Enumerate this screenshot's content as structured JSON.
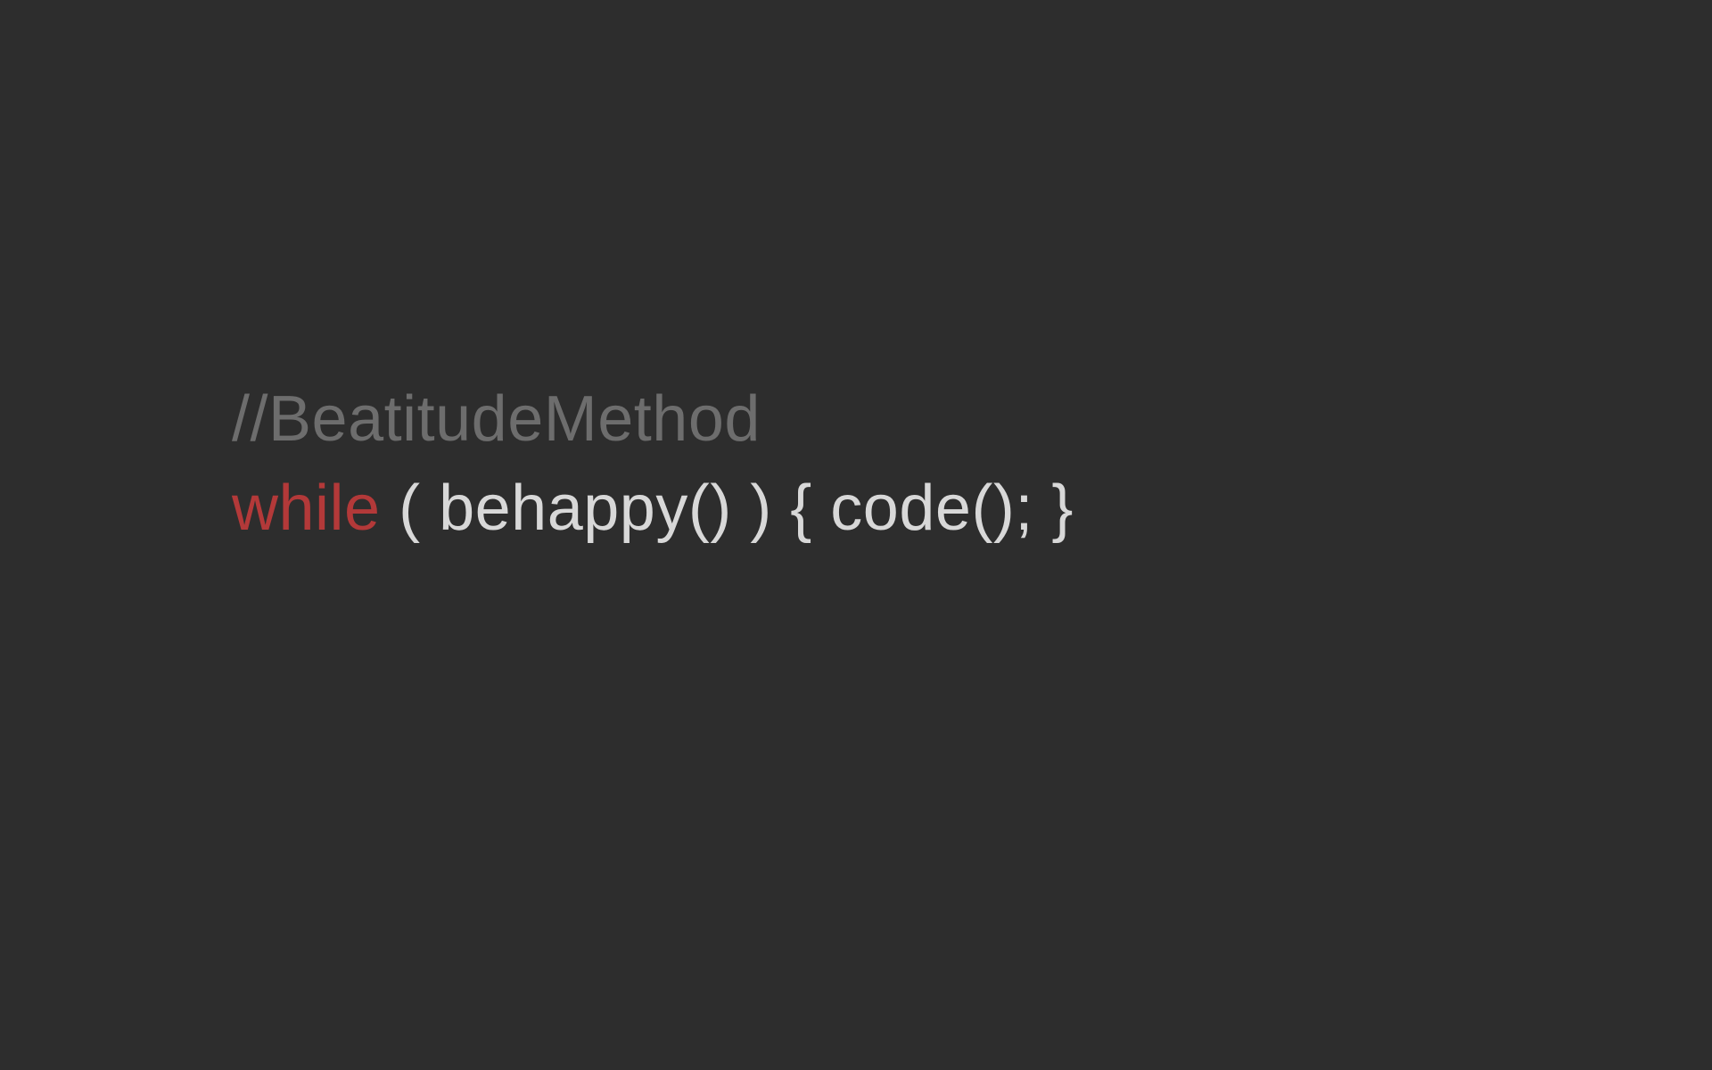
{
  "comment": "//BeatitudeMethod",
  "code": {
    "keyword": "while",
    "rest": " ( behappy() ) { code(); }"
  }
}
